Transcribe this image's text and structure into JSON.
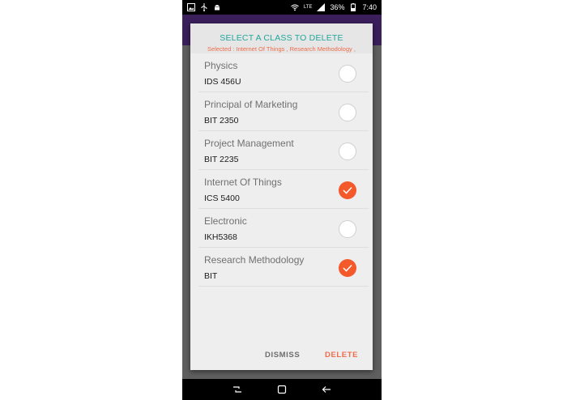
{
  "status_bar": {
    "battery": "36%",
    "time": "7:40",
    "network": "LTE",
    "icons": [
      "image-icon",
      "usb-icon",
      "android-icon",
      "wifi-icon",
      "signal-icon",
      "battery-icon"
    ]
  },
  "dialog": {
    "title": "SELECT A CLASS TO DELETE",
    "selected_text": "Selected : Internet Of Things , Research Methodology ,",
    "items": [
      {
        "name": "Physics",
        "code": "IDS 456U",
        "checked": false
      },
      {
        "name": "Principal of Marketing",
        "code": "BIT 2350",
        "checked": false
      },
      {
        "name": "Project Management",
        "code": "BIT 2235",
        "checked": false
      },
      {
        "name": "Internet Of Things",
        "code": "ICS 5400",
        "checked": true
      },
      {
        "name": "Electronic",
        "code": "IKH5368",
        "checked": false
      },
      {
        "name": "Research Methodology",
        "code": "BIT",
        "checked": true
      }
    ],
    "dismiss_label": "DISMISS",
    "delete_label": "DELETE"
  },
  "nav_bar": {
    "icons": [
      "recents-icon",
      "home-icon",
      "back-icon"
    ]
  },
  "colors": {
    "accent_teal": "#1fa79a",
    "accent_orange": "#f4592b",
    "app_bar": "#3a1f5b"
  }
}
